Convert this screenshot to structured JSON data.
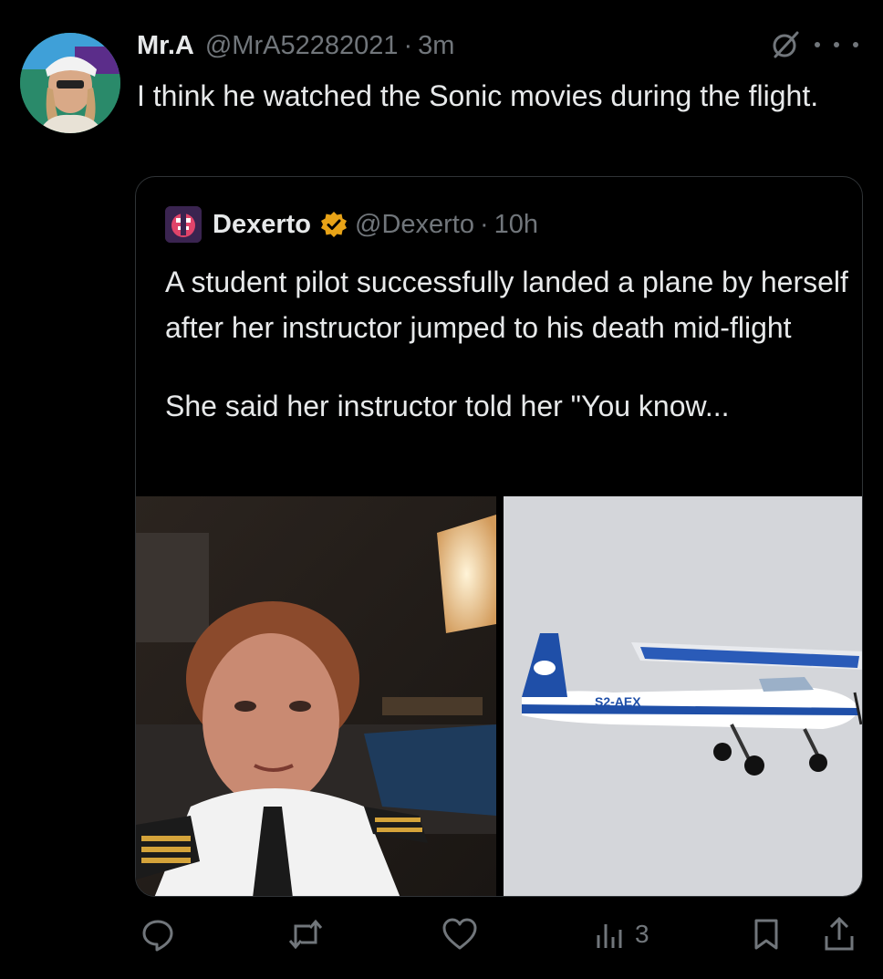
{
  "tweet": {
    "author_name": "Mr.A",
    "author_handle": "@MrA52282021",
    "separator": "·",
    "time": "3m",
    "text": "I think he watched the Sonic movies during the flight."
  },
  "quote": {
    "author_name": "Dexerto",
    "author_handle": "@Dexerto",
    "separator": "·",
    "time": "10h",
    "paragraph1": "A student pilot successfully landed a plane by herself after her instructor jumped to his death mid-flight",
    "paragraph2": "She said her instructor told her \"You know...",
    "plane_registration": "S2-AEX"
  },
  "actions": {
    "views_count": "3"
  },
  "icons": {
    "reply": "reply-icon",
    "retweet": "retweet-icon",
    "like": "like-icon",
    "views": "views-icon",
    "bookmark": "bookmark-icon",
    "share": "share-icon",
    "grok": "grok-icon",
    "more": "more-icon",
    "verified": "verified-badge-icon"
  },
  "colors": {
    "background": "#000000",
    "text": "#e7e9ea",
    "secondary": "#71767b",
    "border": "#2f3336",
    "verified": "#e8a317"
  }
}
